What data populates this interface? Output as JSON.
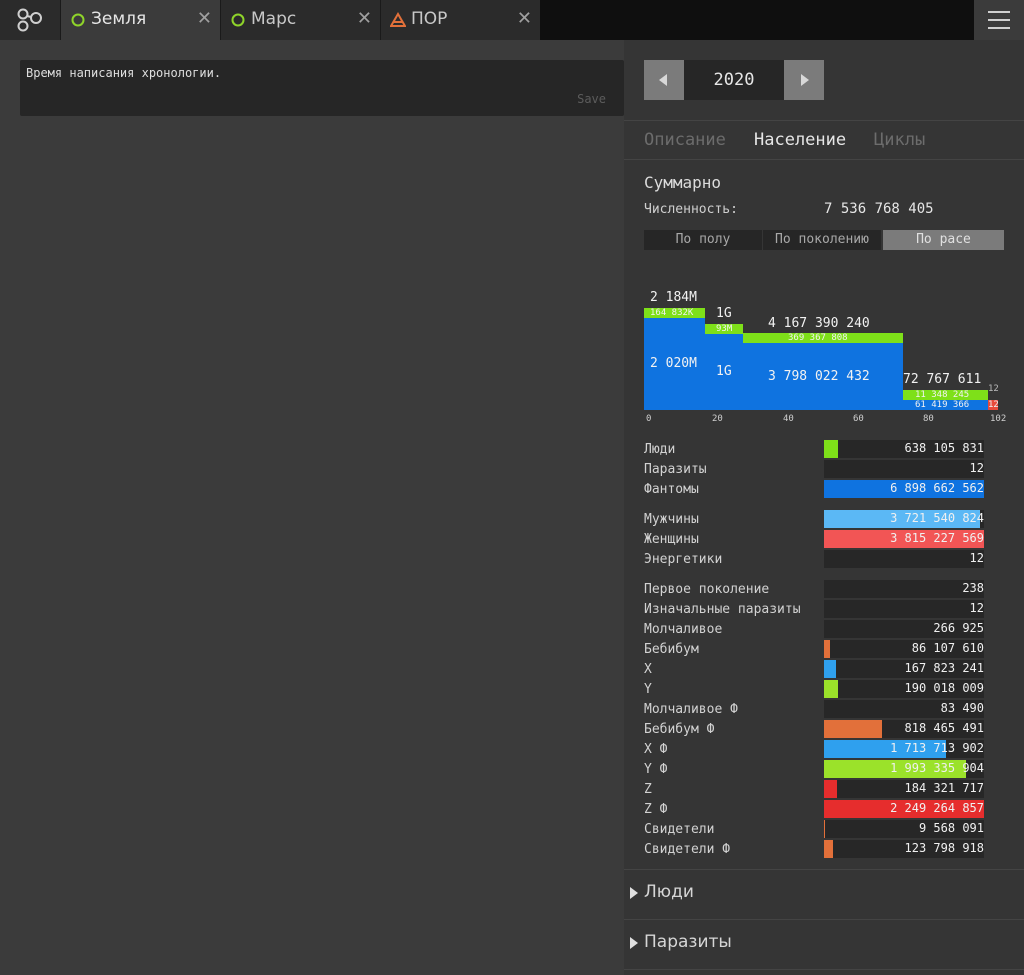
{
  "tabs": [
    {
      "label": "Земля",
      "icon": "circle-icon",
      "color": "#8fd42a",
      "active": true
    },
    {
      "label": "Марс",
      "icon": "circle-icon",
      "color": "#8fd42a",
      "active": false
    },
    {
      "label": "ПОР",
      "icon": "triangle-warning-icon",
      "color": "#e2703a",
      "active": false
    }
  ],
  "note": {
    "placeholder": "Время написания хронологии.",
    "save_label": "Save"
  },
  "year": {
    "value": "2020"
  },
  "panel_tabs": [
    "Описание",
    "Население",
    "Циклы"
  ],
  "summary": {
    "title": "Суммарно",
    "count_label": "Численность:",
    "count_value": "7 536 768 405",
    "segments": [
      "По полу",
      "По поколению",
      "По расе"
    ]
  },
  "chart_data": {
    "type": "bar",
    "x_ticks": [
      "0",
      "20",
      "40",
      "60",
      "80",
      "102"
    ],
    "groups": [
      {
        "total_label": "2 184M",
        "green_label": "164 832K",
        "blue_label": "2 020M"
      },
      {
        "total_label": "1G",
        "green_label": "93M",
        "blue_label": "1G"
      },
      {
        "total_label": "4 167 390 240",
        "green_label": "369 367 808",
        "blue_label": "3 798 022 432"
      },
      {
        "total_label": "72 767 611",
        "green_label": "11 348 245",
        "blue_label": "61 419 366"
      },
      {
        "total_label": "12",
        "green_label": "",
        "blue_label": "12"
      }
    ],
    "colors": {
      "green": "#7ee019",
      "blue": "#0f73e0",
      "red": "#e84a3a"
    }
  },
  "stats": {
    "group1": [
      {
        "name": "Люди",
        "value": "638 105 831",
        "fraction": 0.085,
        "color": "#7ee019"
      },
      {
        "name": "Паразиты",
        "value": "12",
        "fraction": 0,
        "color": "#7ee019"
      },
      {
        "name": "Фантомы",
        "value": "6 898 662 562",
        "fraction": 1.0,
        "color": "#0f73e0"
      }
    ],
    "group2": [
      {
        "name": "Мужчины",
        "value": "3 721 540 824",
        "fraction": 0.975,
        "color": "#5bb8f5"
      },
      {
        "name": "Женщины",
        "value": "3 815 227 569",
        "fraction": 1.0,
        "color": "#f25555"
      },
      {
        "name": "Энергетики",
        "value": "12",
        "fraction": 0,
        "color": "#7ee019"
      }
    ],
    "group3": [
      {
        "name": "Первое поколение",
        "value": "238",
        "fraction": 0,
        "color": "#e2703a"
      },
      {
        "name": "Изначальные паразиты",
        "value": "12",
        "fraction": 0,
        "color": "#e2703a"
      },
      {
        "name": "Молчаливое",
        "value": "266 925",
        "fraction": 0,
        "color": "#e2703a"
      },
      {
        "name": "Бебибум",
        "value": "86 107 610",
        "fraction": 0.038,
        "color": "#e2703a"
      },
      {
        "name": "X",
        "value": "167 823 241",
        "fraction": 0.075,
        "color": "#2fa0ee"
      },
      {
        "name": "Y",
        "value": "190 018 009",
        "fraction": 0.085,
        "color": "#9be22a"
      },
      {
        "name": "Молчаливое Ф",
        "value": "83 490",
        "fraction": 0,
        "color": "#e2703a"
      },
      {
        "name": "Бебибум Ф",
        "value": "818 465 491",
        "fraction": 0.364,
        "color": "#e2703a"
      },
      {
        "name": "X Ф",
        "value": "1 713 713 902",
        "fraction": 0.762,
        "color": "#2fa0ee"
      },
      {
        "name": "Y Ф",
        "value": "1 993 335 904",
        "fraction": 0.886,
        "color": "#9be22a"
      },
      {
        "name": "Z",
        "value": "184 321 717",
        "fraction": 0.082,
        "color": "#e62d2d"
      },
      {
        "name": "Z Ф",
        "value": "2 249 264 857",
        "fraction": 1.0,
        "color": "#e62d2d"
      },
      {
        "name": "Свидетели",
        "value": "9 568 091",
        "fraction": 0.005,
        "color": "#e2703a"
      },
      {
        "name": "Свидетели Ф",
        "value": "123 798 918",
        "fraction": 0.055,
        "color": "#e2703a"
      }
    ]
  },
  "collapsibles": [
    {
      "label": "Люди"
    },
    {
      "label": "Паразиты"
    }
  ]
}
